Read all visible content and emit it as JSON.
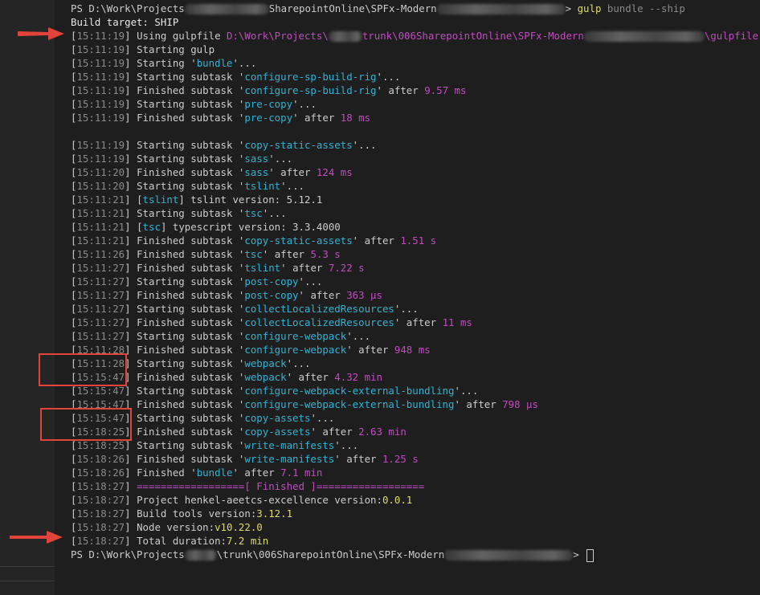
{
  "prompt_lines": {
    "first_prefix": "PS D:\\Work\\Projects",
    "first_mid": "SharepointOnline\\SPFx-Modern",
    "first_gt": ">",
    "first_cmd": "gulp",
    "first_args": "bundle --ship",
    "last_prefix": "PS D:\\Work\\Projects",
    "last_mid": "\\trunk\\006SharepointOnline\\SPFx-Modern",
    "last_gt": ">"
  },
  "build_target": "Build target: SHIP",
  "gulpfile_line": {
    "ts": "15:11:19",
    "text": "Using gulpfile ",
    "path_a": "D:\\Work\\Projects\\",
    "path_b": "trunk\\006SharepointOnline\\SPFx-Modern",
    "path_c": "\\gulpfile.js"
  },
  "block1": [
    {
      "ts": "15:11:19",
      "pre": "Starting gulp",
      "name": "",
      "post": "",
      "dur": ""
    },
    {
      "ts": "15:11:19",
      "pre": "Starting ",
      "name": "bundle",
      "post": "...",
      "dur": ""
    },
    {
      "ts": "15:11:19",
      "pre": "Starting subtask ",
      "name": "configure-sp-build-rig",
      "post": "...",
      "dur": ""
    },
    {
      "ts": "15:11:19",
      "pre": "Finished subtask ",
      "name": "configure-sp-build-rig",
      "post": " after ",
      "dur": "9.57 ms"
    },
    {
      "ts": "15:11:19",
      "pre": "Starting subtask ",
      "name": "pre-copy",
      "post": "...",
      "dur": ""
    },
    {
      "ts": "15:11:19",
      "pre": "Finished subtask ",
      "name": "pre-copy",
      "post": " after ",
      "dur": "18 ms"
    }
  ],
  "block2": [
    {
      "ts": "15:11:19",
      "pre": "Starting subtask ",
      "name": "copy-static-assets",
      "post": "...",
      "dur": ""
    },
    {
      "ts": "15:11:19",
      "pre": "Starting subtask ",
      "name": "sass",
      "post": "...",
      "dur": ""
    },
    {
      "ts": "15:11:20",
      "pre": "Finished subtask ",
      "name": "sass",
      "post": " after ",
      "dur": "124 ms"
    },
    {
      "ts": "15:11:20",
      "pre": "Starting subtask ",
      "name": "tslint",
      "post": "...",
      "dur": ""
    },
    {
      "ts": "15:11:21",
      "tag": "tslint",
      "rest": " tslint version: 5.12.1"
    },
    {
      "ts": "15:11:21",
      "pre": "Starting subtask ",
      "name": "tsc",
      "post": "...",
      "dur": ""
    },
    {
      "ts": "15:11:21",
      "tag": "tsc",
      "rest": " typescript version: 3.3.4000"
    },
    {
      "ts": "15:11:21",
      "pre": "Finished subtask ",
      "name": "copy-static-assets",
      "post": " after ",
      "dur": "1.51 s"
    },
    {
      "ts": "15:11:26",
      "pre": "Finished subtask ",
      "name": "tsc",
      "post": " after ",
      "dur": "5.3 s"
    },
    {
      "ts": "15:11:27",
      "pre": "Finished subtask ",
      "name": "tslint",
      "post": " after ",
      "dur": "7.22 s"
    },
    {
      "ts": "15:11:27",
      "pre": "Starting subtask ",
      "name": "post-copy",
      "post": "...",
      "dur": ""
    },
    {
      "ts": "15:11:27",
      "pre": "Finished subtask ",
      "name": "post-copy",
      "post": " after ",
      "dur": "363 µs"
    },
    {
      "ts": "15:11:27",
      "pre": "Starting subtask ",
      "name": "collectLocalizedResources",
      "post": "...",
      "dur": ""
    },
    {
      "ts": "15:11:27",
      "pre": "Finished subtask ",
      "name": "collectLocalizedResources",
      "post": " after ",
      "dur": "11 ms"
    },
    {
      "ts": "15:11:27",
      "pre": "Starting subtask ",
      "name": "configure-webpack",
      "post": "...",
      "dur": ""
    },
    {
      "ts": "15:11:28",
      "pre": "Finished subtask ",
      "name": "configure-webpack",
      "post": " after ",
      "dur": "948 ms"
    },
    {
      "ts": "15:11:28",
      "pre": "Starting subtask ",
      "name": "webpack",
      "post": "...",
      "dur": ""
    },
    {
      "ts": "15:15:47",
      "pre": "Finished subtask ",
      "name": "webpack",
      "post": " after ",
      "dur": "4.32 min"
    },
    {
      "ts": "15:15:47",
      "pre": "Starting subtask ",
      "name": "configure-webpack-external-bundling",
      "post": "...",
      "dur": ""
    },
    {
      "ts": "15:15:47",
      "pre": "Finished subtask ",
      "name": "configure-webpack-external-bundling",
      "post": " after ",
      "dur": "798 µs"
    },
    {
      "ts": "15:15:47",
      "pre": "Starting subtask ",
      "name": "copy-assets",
      "post": "...",
      "dur": ""
    },
    {
      "ts": "15:18:25",
      "pre": "Finished subtask ",
      "name": "copy-assets",
      "post": " after ",
      "dur": "2.63 min"
    },
    {
      "ts": "15:18:25",
      "pre": "Starting subtask ",
      "name": "write-manifests",
      "post": "...",
      "dur": ""
    },
    {
      "ts": "15:18:26",
      "pre": "Finished subtask ",
      "name": "write-manifests",
      "post": " after ",
      "dur": "1.25 s"
    },
    {
      "ts": "15:18:26",
      "pre": "Finished ",
      "name": "bundle",
      "post": " after ",
      "dur": "7.1 min"
    }
  ],
  "summary": {
    "banner_ts": "15:18:27",
    "banner": "==================[ Finished ]==================",
    "project_ts": "15:18:27",
    "project_label": "Project henkel-aeetcs-excellence version:",
    "project_version": "0.0.1",
    "tools_ts": "15:18:27",
    "tools_label": "Build tools version:",
    "tools_version": "3.12.1",
    "node_ts": "15:18:27",
    "node_label": "Node version:",
    "node_version": "v10.22.0",
    "duration_ts": "15:18:27",
    "duration_label": "Total duration:",
    "duration_value": "7.2 min"
  },
  "colors": {
    "background": "#1e1e1e",
    "timestamp": "#8a8a8a",
    "task_name": "#2fb3d4",
    "duration": "#c04cc0",
    "command": "#dcdc6a",
    "annotation": "#e0443a"
  }
}
